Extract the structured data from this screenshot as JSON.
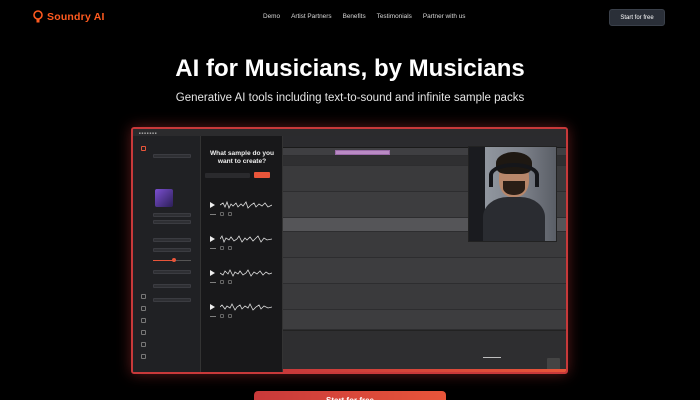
{
  "brand": {
    "name": "Soundry AI",
    "accent": "#ff5a1f"
  },
  "nav": {
    "links": [
      "Demo",
      "Artist Partners",
      "Benefits",
      "Testimonials",
      "Partner with us"
    ],
    "cta": "Start for free"
  },
  "hero": {
    "title": "AI for Musicians, by Musicians",
    "subtitle": "Generative AI tools including text-to-sound and infinite sample packs"
  },
  "app": {
    "prompt_question": "What sample do you want to create?",
    "sample_count": 4
  },
  "colors": {
    "screen_border": "#c8393a",
    "cta_gradient_start": "#c8393a",
    "cta_gradient_end": "#e8553a"
  },
  "bottom_cta": {
    "label": "Start for free"
  }
}
